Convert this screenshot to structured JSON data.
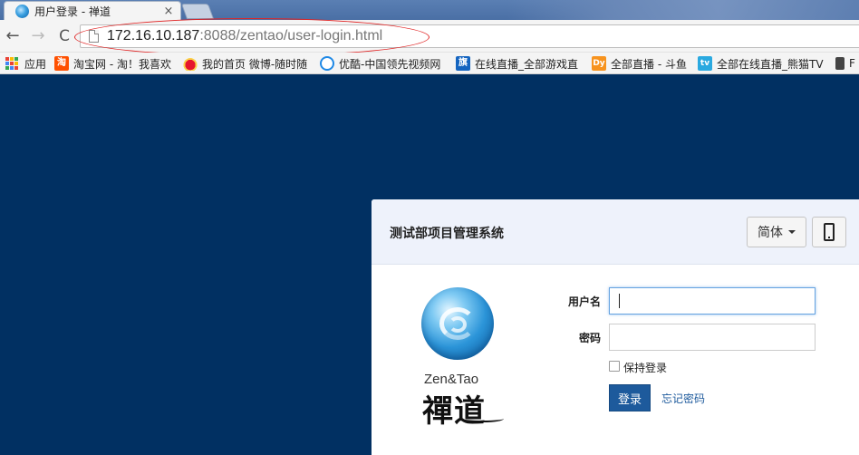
{
  "browser": {
    "tab": {
      "title": "用户登录 - 禅道",
      "close_glyph": "×"
    },
    "nav": {
      "back_glyph": "←",
      "forward_glyph": "→",
      "reload_glyph": "C"
    },
    "address": {
      "host": "172.16.10.187",
      "path": ":8088/zentao/user-login.html"
    },
    "annotation_color": "#e02424"
  },
  "bookmarks": [
    {
      "label": "应用",
      "icon": "apps-grid-icon"
    },
    {
      "label": "淘宝网 - 淘！我喜欢",
      "icon": "taobao-icon",
      "badge": "淘",
      "color": "#ff5000"
    },
    {
      "label": "我的首页 微博-随时随",
      "icon": "weibo-icon",
      "color": "#e6162d"
    },
    {
      "label": "优酷-中国领先视频网",
      "icon": "youku-icon",
      "color": "#1e88e5"
    },
    {
      "label": "在线直播_全部游戏直",
      "icon": "zhanqi-icon",
      "badge": "旗",
      "color": "#1565c0"
    },
    {
      "label": "全部直播 - 斗鱼",
      "icon": "douyu-icon",
      "badge": "Dy",
      "color": "#f7931e"
    },
    {
      "label": "全部在线直播_熊猫TV",
      "icon": "pandatv-icon",
      "badge": "tv",
      "color": "#2aa9e0"
    },
    {
      "label": "F",
      "icon": "bookmark-icon"
    }
  ],
  "login": {
    "title": "测试部项目管理系统",
    "lang_label": "简体",
    "logo_en": "Zen&Tao",
    "logo_cn": "禪道",
    "username_label": "用户名",
    "username_value": "",
    "password_label": "密码",
    "password_value": "",
    "keep_login_label": "保持登录",
    "login_button": "登录",
    "forgot_link": "忘记密码"
  },
  "colors": {
    "background": "#013062",
    "primary": "#1d5a9c",
    "header": "#eef2fb"
  }
}
